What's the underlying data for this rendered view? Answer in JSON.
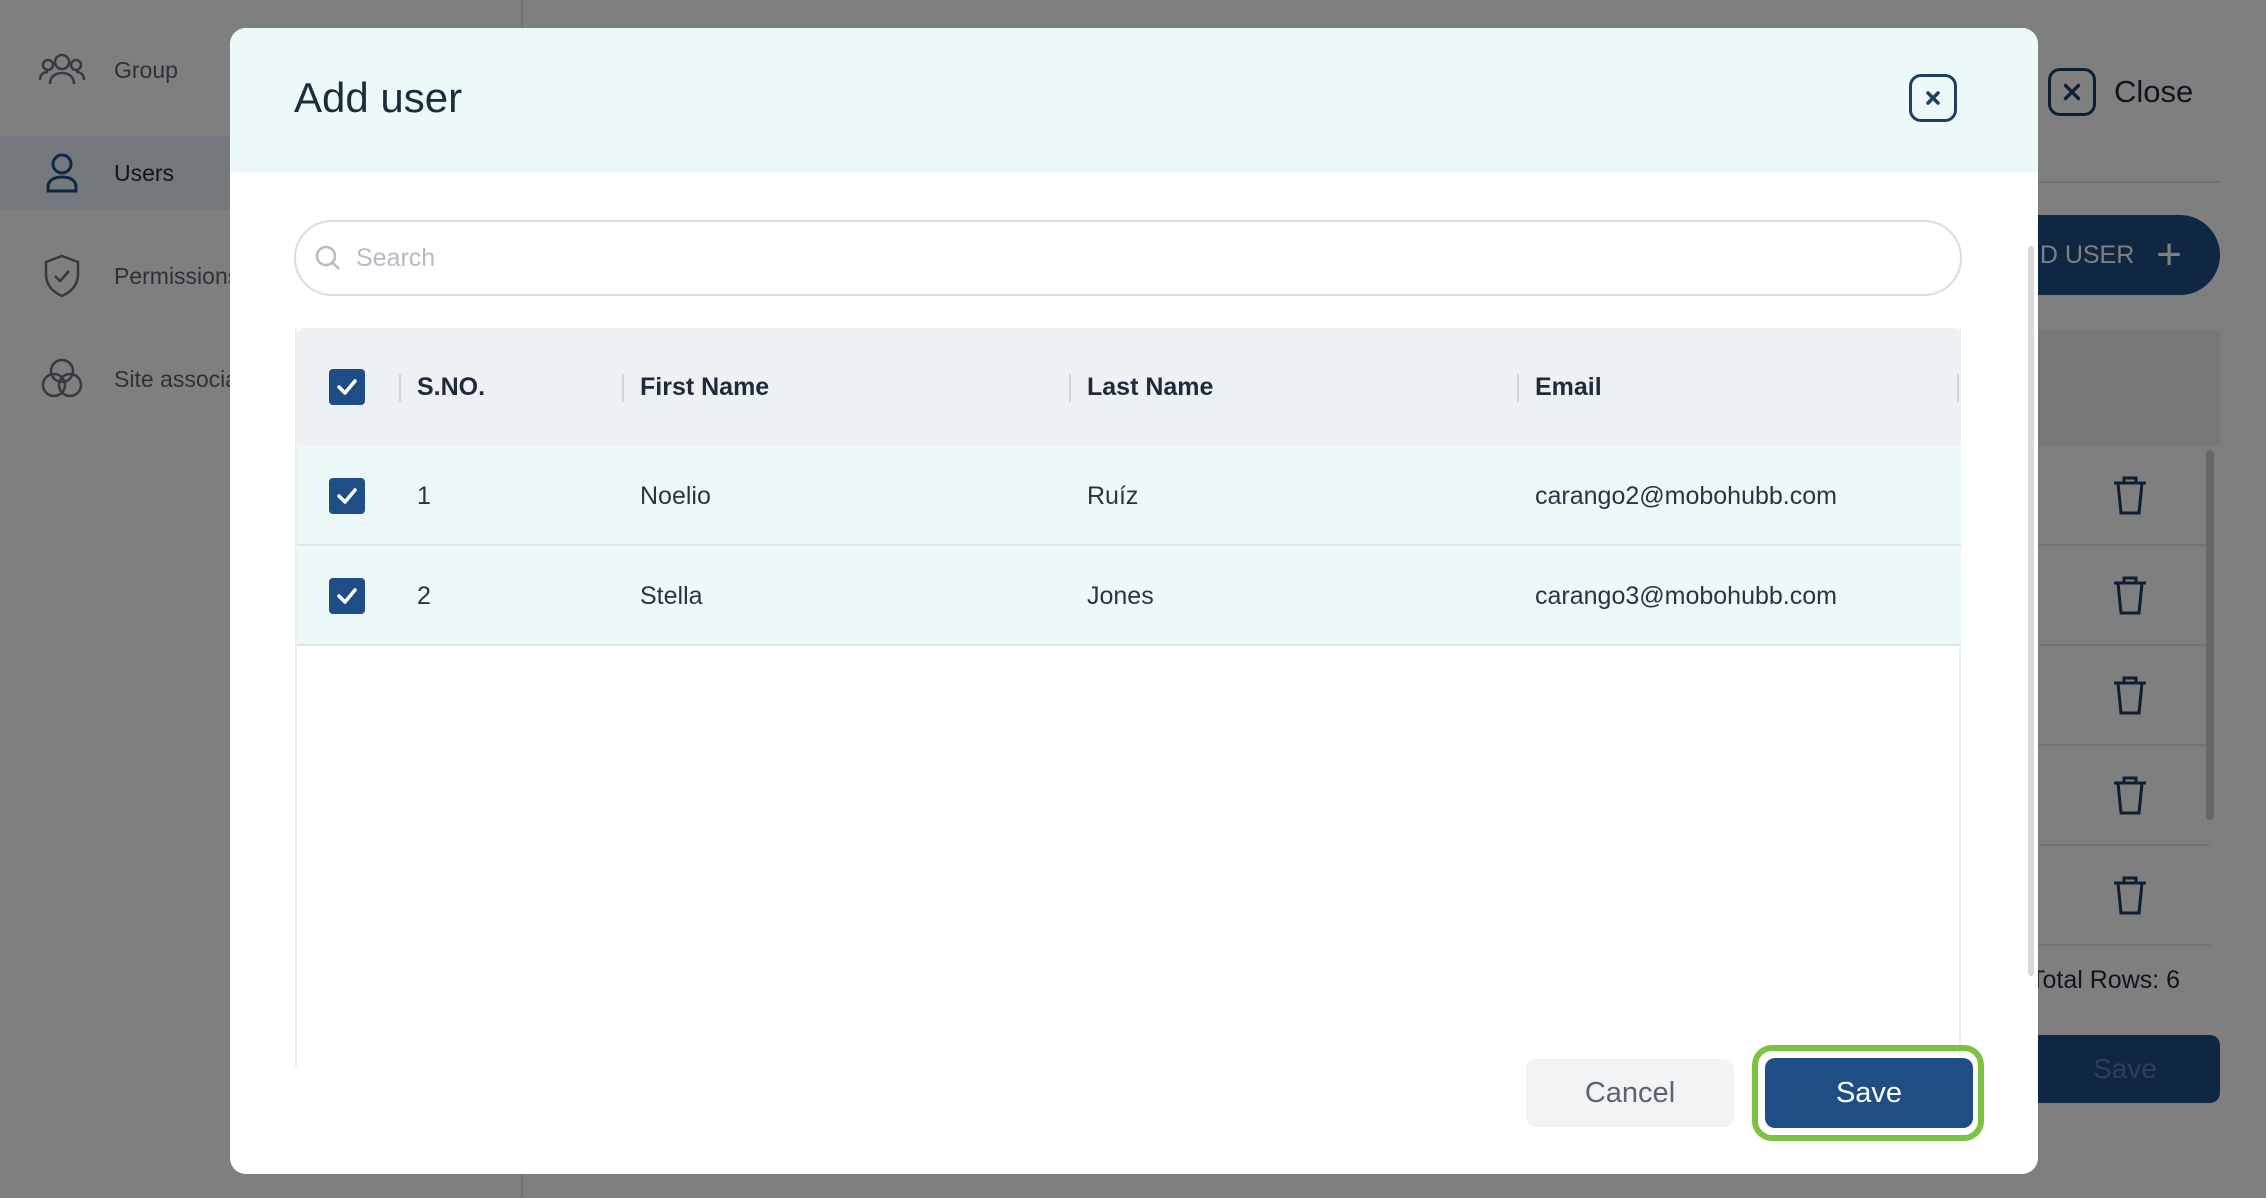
{
  "sidebar": {
    "items": [
      {
        "label": "Group",
        "icon": "group-icon",
        "active": false
      },
      {
        "label": "Users",
        "icon": "user-icon",
        "active": true
      },
      {
        "label": "Permissions",
        "icon": "shield-check-icon",
        "active": false
      },
      {
        "label": "Site associat",
        "icon": "site-association-icon",
        "active": false
      }
    ]
  },
  "background": {
    "close_label": "Close",
    "add_user_label": "D USER",
    "total_rows": "Total Rows: 6",
    "save_label": "Save"
  },
  "modal": {
    "title": "Add user",
    "search_placeholder": "Search",
    "search_value": "",
    "columns": [
      "S.NO.",
      "First Name",
      "Last Name",
      "Email"
    ],
    "header_checked": true,
    "rows": [
      {
        "sno": "1",
        "first_name": "Noelio",
        "last_name": "Ruíz",
        "email": "carango2@mobohubb.com",
        "checked": true
      },
      {
        "sno": "2",
        "first_name": "Stella",
        "last_name": "Jones",
        "email": "carango3@mobohubb.com",
        "checked": true
      }
    ],
    "cancel_label": "Cancel",
    "save_label": "Save"
  },
  "colors": {
    "primary": "#1f4e86",
    "header_bg": "#edf8f8",
    "highlight": "#7cc242"
  }
}
